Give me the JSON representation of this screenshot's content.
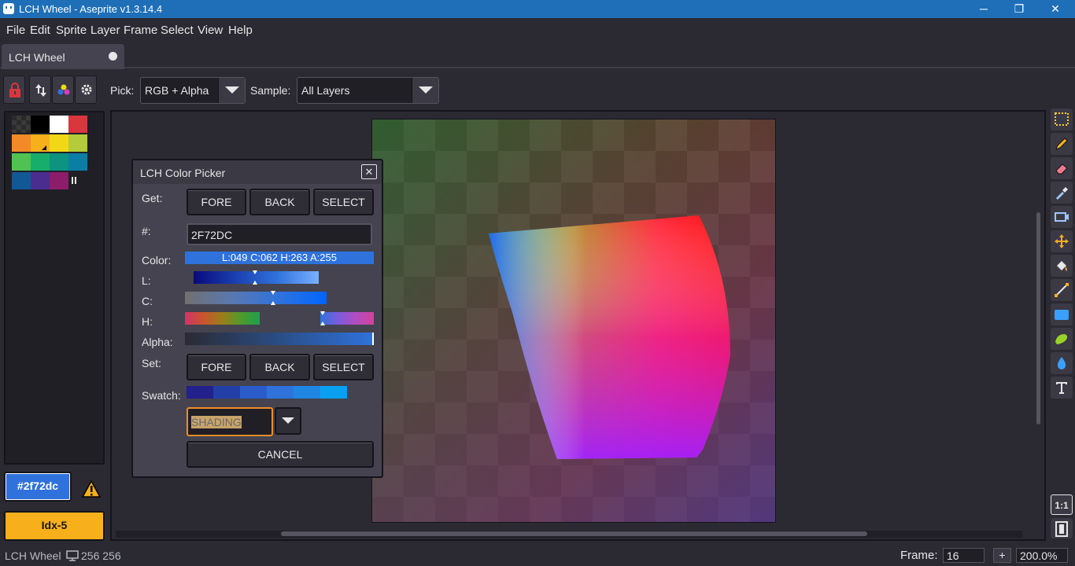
{
  "window": {
    "title": "LCH Wheel - Aseprite v1.3.14.4",
    "controls": {
      "minimize": "─",
      "maximize": "❐",
      "close": "✕"
    }
  },
  "menu": [
    "File",
    "Edit",
    "Sprite",
    "Layer",
    "Frame",
    "Select",
    "View",
    "Help"
  ],
  "tab": {
    "label": "LCH Wheel"
  },
  "toolbar": {
    "pick_label": "Pick:",
    "pick_value": "RGB + Alpha",
    "sample_label": "Sample:",
    "sample_value": "All Layers"
  },
  "palette": {
    "colors": [
      "#2b2b2b",
      "#000000",
      "#ffffff",
      "#d9363e",
      "#f28b27",
      "#f7b01b",
      "#f2d814",
      "#b4cc39",
      "#50c252",
      "#17ae6b",
      "#0c9480",
      "#0b7ea6",
      "#115896",
      "#4b2d8f",
      "#8d1d6b"
    ],
    "fg_color": "#2f72dc",
    "fg_label": "#2f72dc",
    "bg_color": "#f7b01b",
    "bg_label": "Idx-5"
  },
  "dialog": {
    "title": "LCH Color Picker",
    "close": "✕",
    "get_label": "Get:",
    "get_buttons": [
      "FORE",
      "BACK",
      "SELECT"
    ],
    "hex_label": "#:",
    "hex_value": "2F72DC",
    "color_label": "Color:",
    "color_readout": "L:049 C:062 H:263 A:255",
    "l_label": "L:",
    "c_label": "C:",
    "h_label": "H:",
    "alpha_label": "Alpha:",
    "set_label": "Set:",
    "set_buttons": [
      "FORE",
      "BACK",
      "SELECT"
    ],
    "swatch_label": "Swatch:",
    "swatch_colors": [
      "#22208a",
      "#233fa8",
      "#2a5ccb",
      "#2f72dc",
      "#1f86e4",
      "#0aa0f2"
    ],
    "mode_value": "SHADING",
    "cancel": "CANCEL",
    "l_level": 0.49,
    "c_level": 0.62,
    "h_level": 0.73
  },
  "status": {
    "sprite_name": "LCH Wheel",
    "size": "256 256",
    "frame_label": "Frame:",
    "frame_value": "16",
    "add_frame": "+",
    "zoom": "200.0%"
  }
}
